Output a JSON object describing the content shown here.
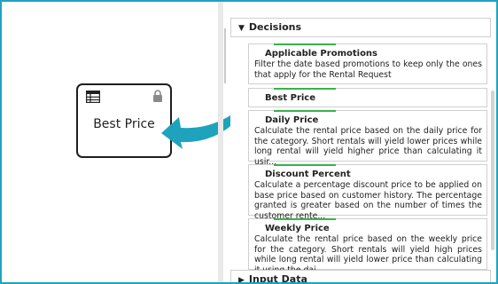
{
  "canvas": {
    "node": {
      "label": "Best Price",
      "icon_type": "decision-table-icon",
      "lock_icon": "lock-icon"
    },
    "arrow_color": "#1fa3bd"
  },
  "panel": {
    "decisions_header": "Decisions",
    "input_data_header": "Input Data",
    "items": [
      {
        "title": "Applicable Promotions",
        "description": "Filter the date based promotions to keep only the ones that apply for the Rental Request"
      },
      {
        "title": "Best Price",
        "description": ""
      },
      {
        "title": "Daily Price",
        "description": "Calculate the rental price based on the daily price for the category. Short rentals will yield lower prices while long rental will yield higher price than calculating it usir..."
      },
      {
        "title": "Discount Percent",
        "description": "Calculate a percentage discount price to be applied on base price based on customer history. The percentage granted is greater based on the number of times the customer rente..."
      },
      {
        "title": "Weekly Price",
        "description": "Calculate the rental price based on the weekly price for the category. Short rentals will yield high prices while long rental will yield lower price than calculating it using the dai..."
      }
    ]
  },
  "colors": {
    "accent": "#1fa3bd",
    "indicator": "#3bb04a"
  }
}
